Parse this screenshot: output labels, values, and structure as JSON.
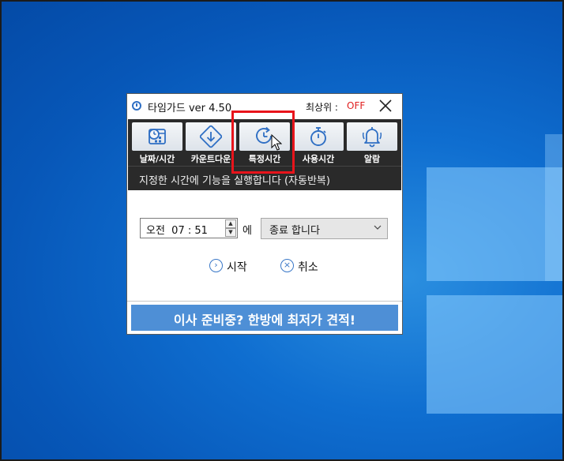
{
  "window": {
    "title": "타임가드 ver 4.50",
    "topmost_label": "최상위 :",
    "topmost_value": "OFF",
    "close_glyph": "✕"
  },
  "toolbar": {
    "items": [
      {
        "label": "날짜/시간",
        "icon": "calendar-clock-icon"
      },
      {
        "label": "카운트다운",
        "icon": "countdown-arrow-icon"
      },
      {
        "label": "특정시간",
        "icon": "specific-time-icon"
      },
      {
        "label": "사용시간",
        "icon": "stopwatch-icon"
      },
      {
        "label": "알람",
        "icon": "bell-icon"
      }
    ]
  },
  "description": "지정한 시간에 기능을 실행합니다 (자동반복)",
  "form": {
    "time_value": "오전  07 : 51",
    "suffix": "에",
    "action_value": "종료 합니다"
  },
  "buttons": {
    "start_label": "시작",
    "cancel_label": "취소"
  },
  "ad": {
    "text": "이사 준비중? 한방에 최저가 견적!"
  },
  "colors": {
    "accent_blue": "#4e8fd6",
    "toolbar_bg": "#2a2a2a",
    "off_red": "#e02020",
    "highlight_red": "#e8141b"
  }
}
